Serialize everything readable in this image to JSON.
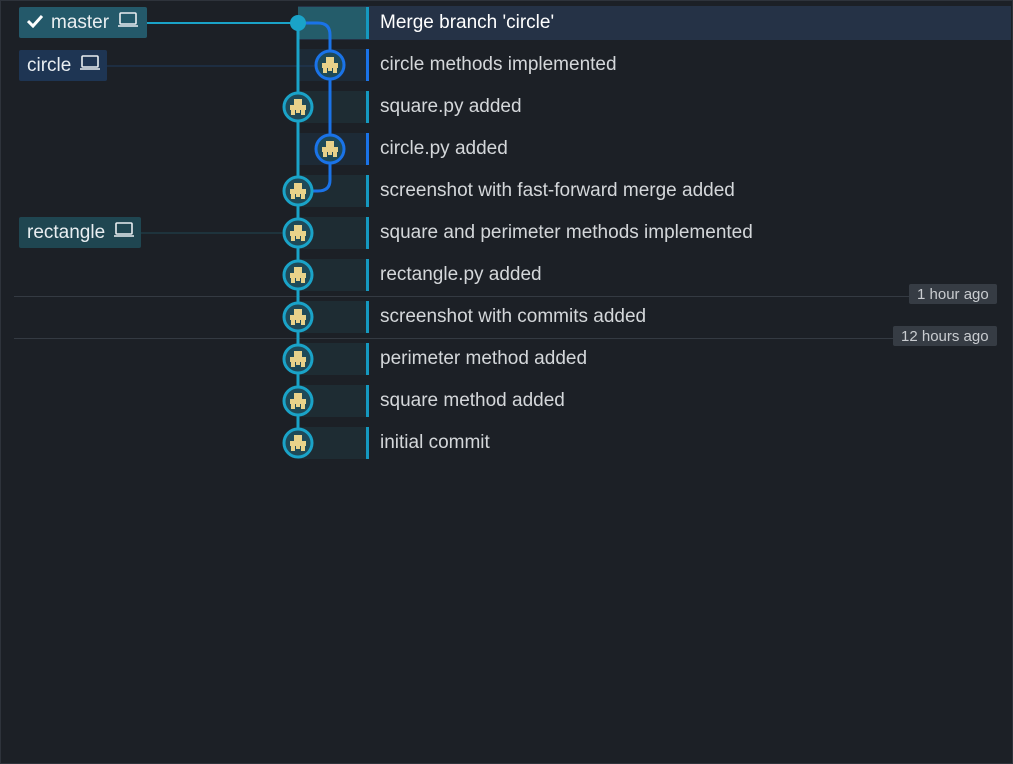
{
  "refs": {
    "master": {
      "label": "master",
      "checked": true,
      "icon": "laptop-icon"
    },
    "circle": {
      "label": "circle",
      "icon": "laptop-icon"
    },
    "rectangle": {
      "label": "rectangle",
      "icon": "laptop-icon"
    }
  },
  "commits": [
    {
      "message": "Merge branch 'circle'",
      "selected": true
    },
    {
      "message": "circle methods implemented",
      "branch": "circle"
    },
    {
      "message": "square.py added"
    },
    {
      "message": "circle.py added",
      "branch": "circle"
    },
    {
      "message": "screenshot with fast-forward merge added"
    },
    {
      "message": "square and perimeter methods implemented"
    },
    {
      "message": "rectangle.py added"
    },
    {
      "message": "screenshot with commits added"
    },
    {
      "message": "perimeter method added"
    },
    {
      "message": "square method added"
    },
    {
      "message": "initial commit"
    }
  ],
  "date_markers": [
    {
      "label": "1 hour ago"
    },
    {
      "label": "12 hours ago"
    }
  ],
  "colors": {
    "master_lane": "#1aa3c8",
    "circle_lane": "#1a73e8",
    "avatar_bg": "#1f4a58",
    "avatar_fg": "#e8d28a"
  }
}
